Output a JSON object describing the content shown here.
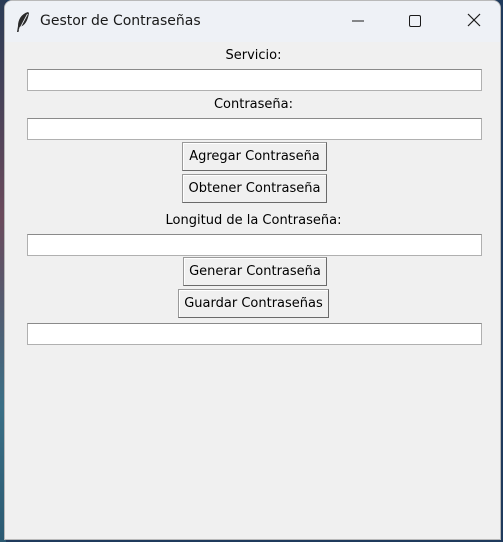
{
  "window": {
    "title": "Gestor de Contraseñas"
  },
  "form": {
    "service_label": "Servicio:",
    "service_value": "",
    "password_label": "Contraseña:",
    "password_value": "",
    "add_button": "Agregar Contraseña",
    "get_button": "Obtener Contraseña",
    "length_label": "Longitud de la Contraseña:",
    "length_value": "",
    "generate_button": "Generar Contraseña",
    "save_button": "Guardar Contraseñas",
    "output_value": ""
  },
  "icons": {
    "app": "feather-icon",
    "minimize": "minimize-icon",
    "maximize": "maximize-icon",
    "close": "close-icon"
  },
  "colors": {
    "background": "#f0f0f0",
    "titlebar": "#eef1f6",
    "entry": "#ffffff"
  }
}
